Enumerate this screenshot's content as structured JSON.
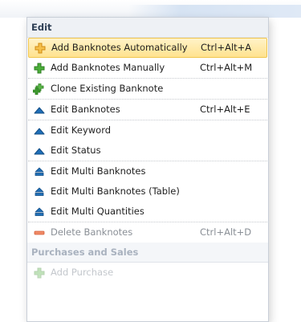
{
  "menu": {
    "sections": [
      {
        "title": "Edit",
        "items": [
          {
            "label": "Add Banknotes Automatically",
            "shortcut": "Ctrl+Alt+A",
            "icon": "plus-orange-icon"
          },
          {
            "label": "Add Banknotes Manually",
            "shortcut": "Ctrl+Alt+M",
            "icon": "plus-green-icon"
          },
          {
            "label": "Clone Existing Banknote",
            "shortcut": "",
            "icon": "clone-plus-icon"
          },
          {
            "label": "Edit Banknotes",
            "shortcut": "Ctrl+Alt+E",
            "icon": "edit-triangle-icon"
          },
          {
            "label": "Edit Keyword",
            "shortcut": "",
            "icon": "edit-triangle-icon"
          },
          {
            "label": "Edit Status",
            "shortcut": "",
            "icon": "edit-triangle-icon"
          },
          {
            "label": "Edit Multi Banknotes",
            "shortcut": "",
            "icon": "edit-multi-icon"
          },
          {
            "label": "Edit Multi Banknotes (Table)",
            "shortcut": "",
            "icon": "edit-multi-icon"
          },
          {
            "label": "Edit Multi Quantities",
            "shortcut": "",
            "icon": "edit-multi-icon"
          },
          {
            "label": "Delete Banknotes",
            "shortcut": "Ctrl+Alt+D",
            "icon": "minus-icon"
          }
        ]
      },
      {
        "title": "Purchases and Sales",
        "items": [
          {
            "label": "Add Purchase",
            "shortcut": "",
            "icon": "plus-green-icon"
          }
        ]
      }
    ]
  },
  "colors": {
    "selected_bg": "#ffe28e",
    "selected_border": "#f0c650",
    "edit_blue": "#1f6fb8",
    "add_green": "#3e9a2e",
    "add_orange": "#f2a81c",
    "delete_red": "#e8734f"
  }
}
